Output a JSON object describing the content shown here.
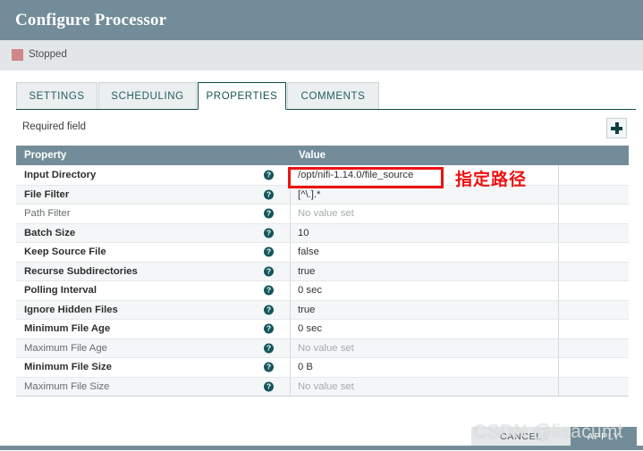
{
  "window": {
    "title": "Configure Processor",
    "header_color": "#728d99"
  },
  "status": {
    "label": "Stopped",
    "indicator_color": "#cf8787"
  },
  "tabs": [
    {
      "label": "SETTINGS",
      "active": false
    },
    {
      "label": "SCHEDULING",
      "active": false
    },
    {
      "label": "PROPERTIES",
      "active": true
    },
    {
      "label": "COMMENTS",
      "active": false
    }
  ],
  "toolbar": {
    "required_field_label": "Required field",
    "add_property_icon": "plus-icon"
  },
  "table": {
    "columns": [
      "Property",
      "Value"
    ],
    "help_icon": "question-mark-icon",
    "rows": [
      {
        "property": "Input Directory",
        "value": "/opt/nifi-1.14.0/file_source",
        "required": true,
        "unset": false
      },
      {
        "property": "File Filter",
        "value": "[^\\.].*",
        "required": true,
        "unset": false
      },
      {
        "property": "Path Filter",
        "value": "No value set",
        "required": false,
        "unset": true
      },
      {
        "property": "Batch Size",
        "value": "10",
        "required": true,
        "unset": false
      },
      {
        "property": "Keep Source File",
        "value": "false",
        "required": true,
        "unset": false
      },
      {
        "property": "Recurse Subdirectories",
        "value": "true",
        "required": true,
        "unset": false
      },
      {
        "property": "Polling Interval",
        "value": "0 sec",
        "required": true,
        "unset": false
      },
      {
        "property": "Ignore Hidden Files",
        "value": "true",
        "required": true,
        "unset": false
      },
      {
        "property": "Minimum File Age",
        "value": "0 sec",
        "required": true,
        "unset": false
      },
      {
        "property": "Maximum File Age",
        "value": "No value set",
        "required": false,
        "unset": true
      },
      {
        "property": "Minimum File Size",
        "value": "0 B",
        "required": true,
        "unset": false
      },
      {
        "property": "Maximum File Size",
        "value": "No value set",
        "required": false,
        "unset": true
      }
    ]
  },
  "annotation": {
    "caption": "指定路径",
    "color": "#ee1111"
  },
  "footer": {
    "cancel_label": "CANCEL",
    "apply_label": "APPLY"
  },
  "watermark": {
    "text": "CSDN @lisacumt"
  }
}
